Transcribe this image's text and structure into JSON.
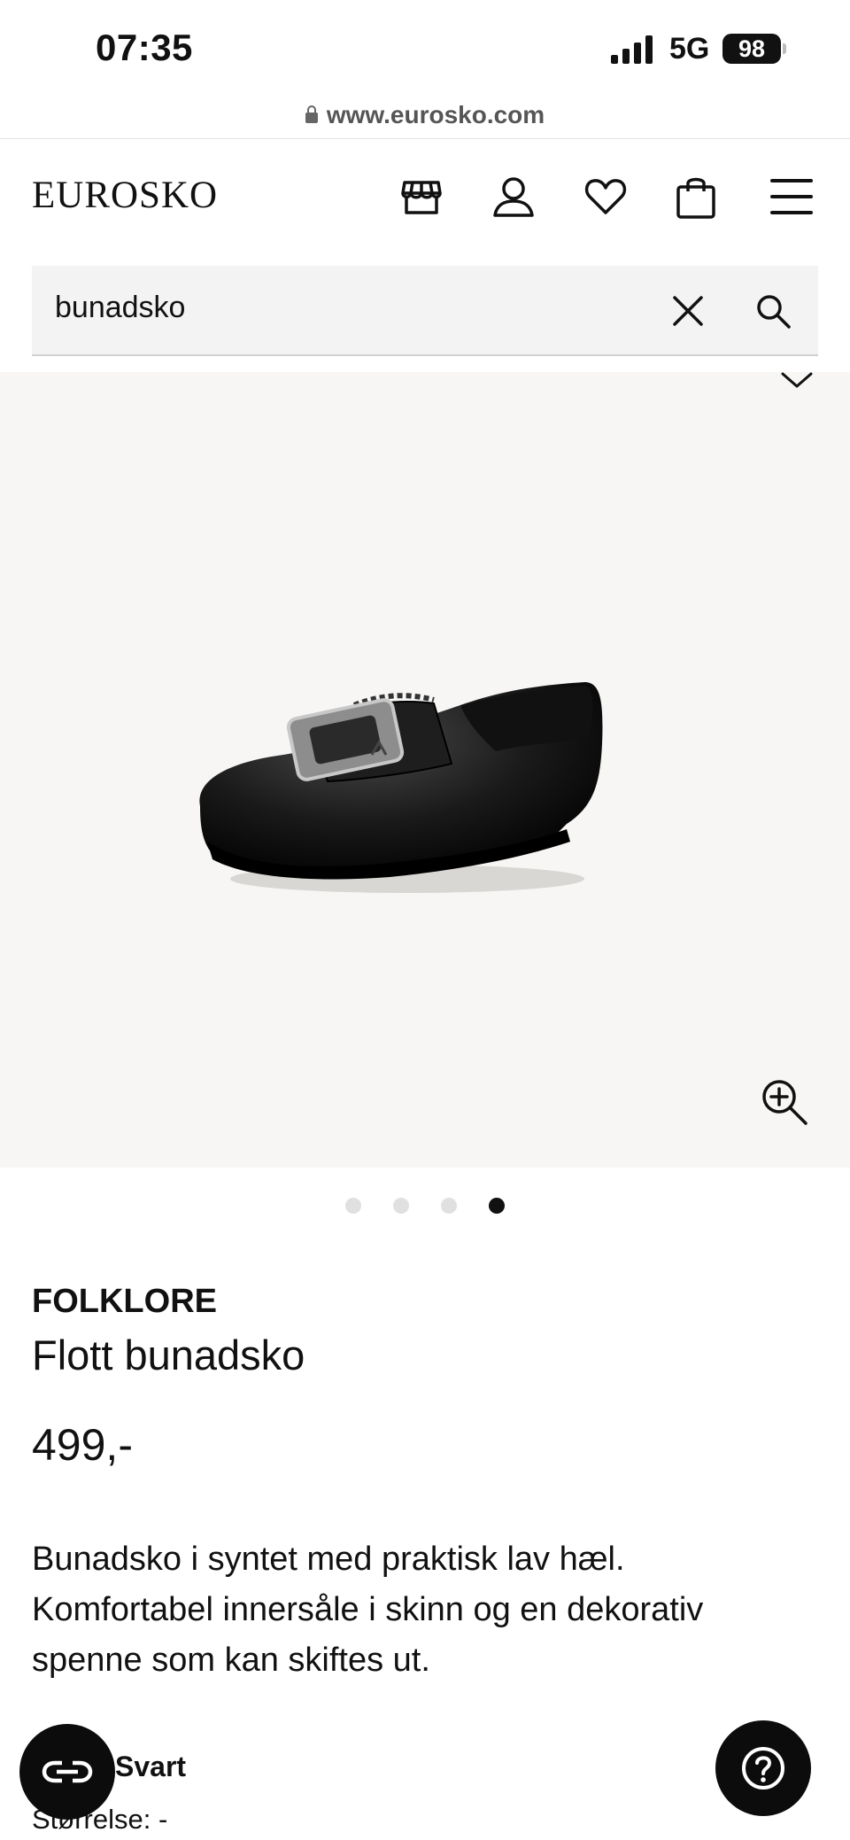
{
  "status_bar": {
    "time": "07:35",
    "network": "5G",
    "battery": "98"
  },
  "browser": {
    "url": "www.eurosko.com"
  },
  "header": {
    "logo": "EUROSKO",
    "icons": [
      "store-icon",
      "user-icon",
      "heart-icon",
      "bag-icon",
      "menu-icon"
    ]
  },
  "search": {
    "value": "bunadsko",
    "placeholder": ""
  },
  "gallery": {
    "total_images": 4,
    "active_index": 3
  },
  "product": {
    "brand": "FOLKLORE",
    "name": "Flott bunadsko",
    "price": "499,-",
    "description_lines": [
      "Bunadsko i syntet med praktisk lav hæl.",
      "Komfortabel innersåle i skinn og en dekorativ",
      "spenne som kan skiftes ut."
    ],
    "color_value": "Svart",
    "size_text": "Størrelse: -"
  },
  "colors": {
    "accent": "#111111",
    "image_bg": "#f7f6f5",
    "search_bg": "#f3f3f3",
    "dot_inactive": "#e0e0e0"
  }
}
